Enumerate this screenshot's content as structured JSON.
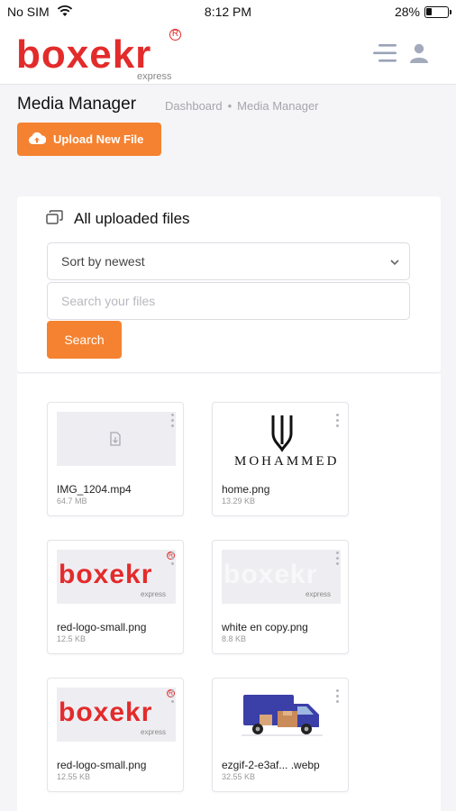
{
  "status_bar": {
    "carrier": "No SIM",
    "time": "8:12 PM",
    "battery_pct": "28%",
    "battery_level": 0.28
  },
  "header": {
    "logo_text": "boxekr",
    "logo_sub": "express",
    "logo_reg": "R"
  },
  "page": {
    "title": "Media Manager",
    "breadcrumb": [
      "Dashboard",
      "Media Manager"
    ],
    "upload_label": "Upload New File"
  },
  "panel": {
    "title": "All uploaded files",
    "sort_value": "Sort by newest",
    "search_placeholder": "Search your files",
    "search_label": "Search"
  },
  "files": [
    {
      "name": "IMG_1204.mp4",
      "size": "64.7 MB",
      "thumb": "file-icon"
    },
    {
      "name": "home.png",
      "size": "13.29 KB",
      "thumb": "mohammed-logo",
      "thumb_text": "MOHAMMED"
    },
    {
      "name": "red-logo-small.png",
      "size": "12.5 KB",
      "thumb": "boxekr-logo-red",
      "thumb_text": "boxekr",
      "thumb_sub": "express"
    },
    {
      "name": "white en copy.png",
      "size": "8.8 KB",
      "thumb": "boxekr-logo-white",
      "thumb_text": "boxekr",
      "thumb_sub": "express"
    },
    {
      "name": "red-logo-small.png",
      "size": "12.55 KB",
      "thumb": "boxekr-logo-red",
      "thumb_text": "boxekr",
      "thumb_sub": "express"
    },
    {
      "name": "ezgif-2-e3af... .webp",
      "size": "32.55 KB",
      "thumb": "delivery-truck"
    }
  ],
  "colors": {
    "accent": "#f58230",
    "brand_red": "#e32b2b",
    "truck_blue": "#3b3fa8"
  }
}
